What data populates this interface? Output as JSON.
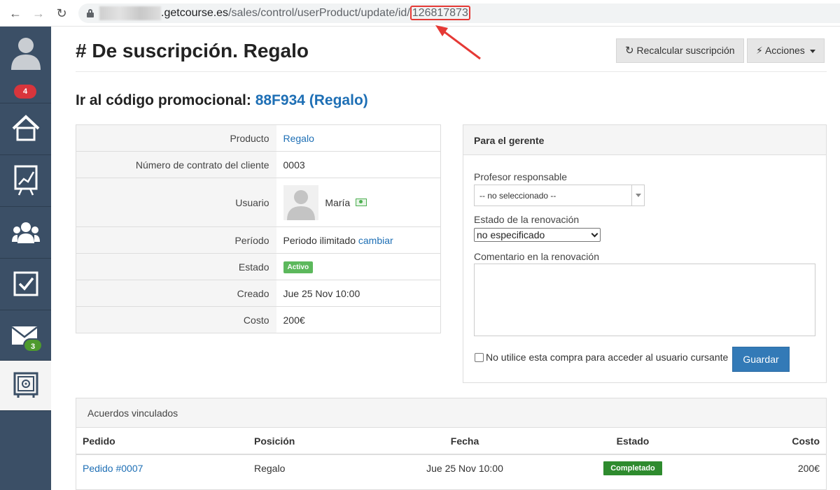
{
  "browser": {
    "url_host": ".getcourse.es",
    "url_path": "/sales/control/userProduct/update/id/",
    "url_id": "126817873"
  },
  "sidebar": {
    "notifications_count": "4",
    "messages_count": "3"
  },
  "header": {
    "title": "# De suscripción. Regalo",
    "recalc_label": "Recalcular suscripción",
    "actions_label": "Acciones"
  },
  "promo": {
    "prefix": "Ir al código promocional:",
    "code": "88F934 (Regalo)"
  },
  "info": {
    "rows": [
      {
        "label": "Producto",
        "value": "Regalo"
      },
      {
        "label": "Número de contrato del cliente",
        "value": "0003"
      },
      {
        "label": "Usuario",
        "value": "María"
      },
      {
        "label": "Período",
        "value": "Periodo ilimitado",
        "link": "cambiar"
      },
      {
        "label": "Estado",
        "value": "Activo"
      },
      {
        "label": "Creado",
        "value": "Jue 25 Nov 10:00"
      },
      {
        "label": "Costo",
        "value": "200€"
      }
    ]
  },
  "manager": {
    "title": "Para el gerente",
    "teacher_label": "Profesor responsable",
    "teacher_value": "-- no seleccionado --",
    "renewal_label": "Estado de la renovación",
    "renewal_value": "no especificado",
    "comment_label": "Comentario en la renovación",
    "checkbox_label": "No utilice esta compra para acceder al usuario cursante",
    "save_label": "Guardar"
  },
  "agreements": {
    "title": "Acuerdos vinculados",
    "columns": [
      "Pedido",
      "Posición",
      "Fecha",
      "Estado",
      "Costo"
    ],
    "rows": [
      {
        "order": "Pedido #0007",
        "position": "Regalo",
        "date": "Jue 25 Nov 10:00",
        "status": "Completado",
        "cost": "200€"
      }
    ]
  },
  "colors": {
    "sidebar": "#3b4f66",
    "link": "#1e6fb5",
    "primary_button": "#337ab7",
    "status_active": "#5cb85c",
    "status_done": "#2e8b2e",
    "badge_red": "#d9353c",
    "highlight": "#e53935"
  }
}
